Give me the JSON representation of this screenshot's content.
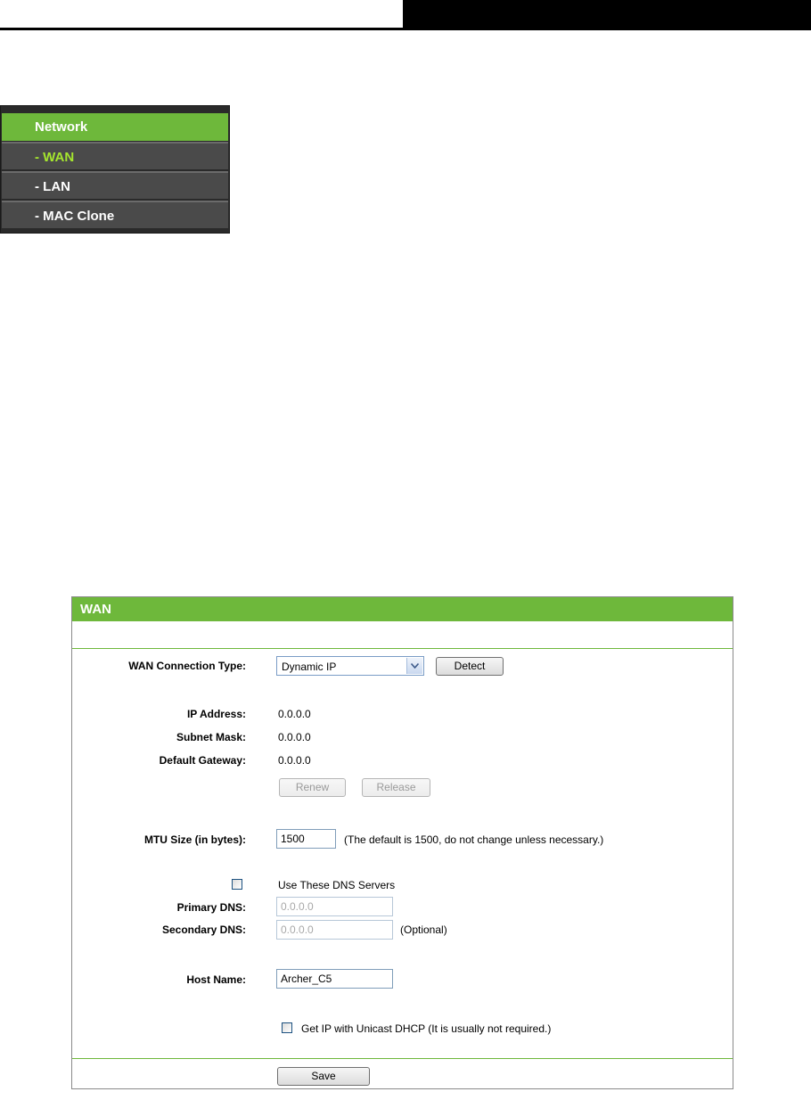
{
  "menu": {
    "title": "Network",
    "items": [
      {
        "label": "- WAN"
      },
      {
        "label": "- LAN"
      },
      {
        "label": "- MAC Clone"
      }
    ]
  },
  "panel": {
    "title": "WAN",
    "connection_type_label": "WAN Connection Type:",
    "connection_type_value": "Dynamic IP",
    "detect_button": "Detect",
    "ip_address_label": "IP Address:",
    "ip_address_value": "0.0.0.0",
    "subnet_mask_label": "Subnet Mask:",
    "subnet_mask_value": "0.0.0.0",
    "default_gateway_label": "Default Gateway:",
    "default_gateway_value": "0.0.0.0",
    "renew_button": "Renew",
    "release_button": "Release",
    "mtu_label": "MTU Size (in bytes):",
    "mtu_value": "1500",
    "mtu_note": "(The default is 1500, do not change unless necessary.)",
    "use_dns_label": "Use These DNS Servers",
    "primary_dns_label": "Primary DNS:",
    "primary_dns_value": "0.0.0.0",
    "secondary_dns_label": "Secondary DNS:",
    "secondary_dns_value": "0.0.0.0",
    "optional_note": "(Optional)",
    "host_name_label": "Host Name:",
    "host_name_value": "Archer_C5",
    "unicast_label": "Get IP with Unicast DHCP (It is usually not required.)",
    "save_button": "Save"
  },
  "colors": {
    "accent_green": "#6eb83b",
    "menu_active_text": "#a5e62e",
    "menu_background": "#4a4a4a"
  }
}
